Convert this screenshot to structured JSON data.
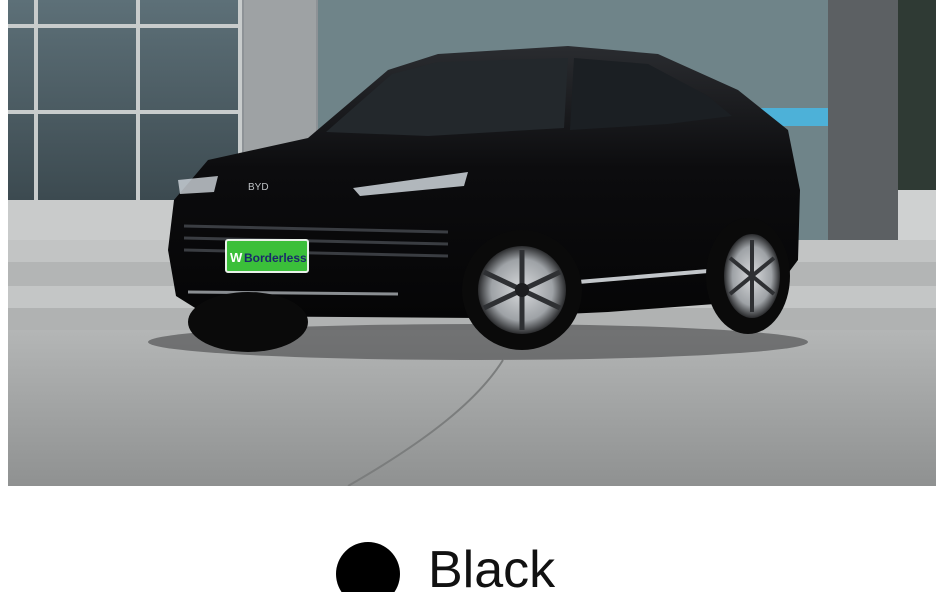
{
  "product_image": {
    "alt": "Black",
    "plate_text": "Borderless",
    "plate_logo_letter": "W",
    "badge_text": "BYD"
  },
  "color_option": {
    "name": "Black",
    "swatch_color": "#000000"
  },
  "colors": {
    "car_body": "#0b0b0d",
    "plate_green": "#3bbf3a",
    "pavement": "#a6a8a8",
    "building": "#8a8f92"
  }
}
